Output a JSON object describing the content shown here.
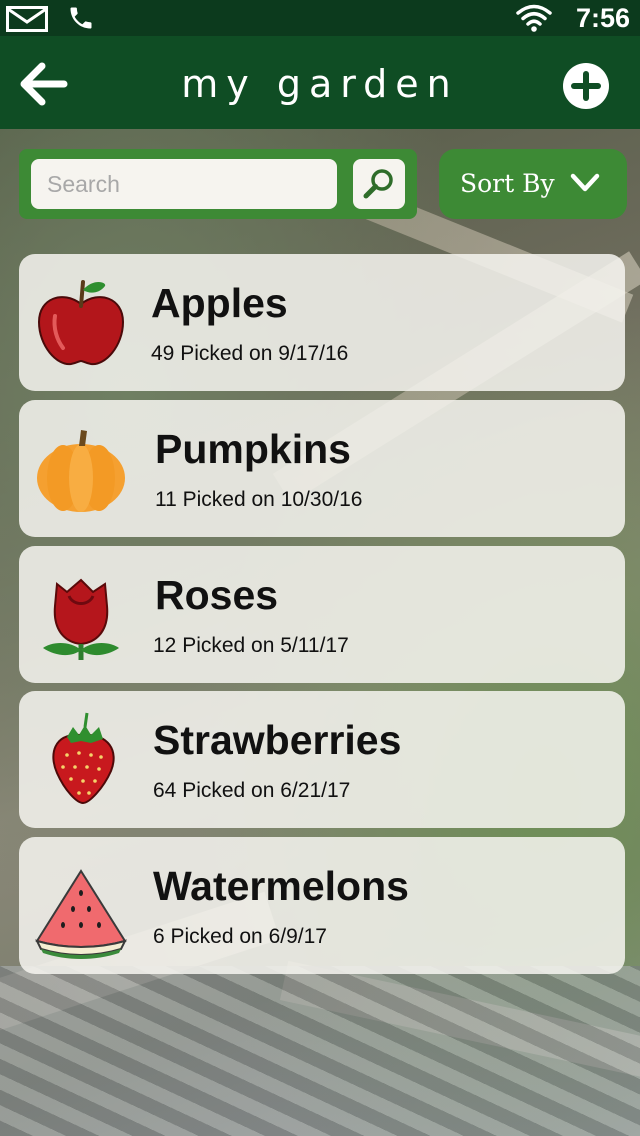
{
  "status_bar": {
    "time": "7:56",
    "icons": [
      "mail-icon",
      "phone-icon",
      "wifi-icon"
    ]
  },
  "app_bar": {
    "title": "my garden",
    "back_icon": "arrow-left-icon",
    "add_icon": "plus-circle-icon"
  },
  "search": {
    "placeholder": "Search",
    "value": "",
    "button_icon": "magnifier-icon"
  },
  "sort": {
    "label": "Sort By",
    "icon": "chevron-down-icon"
  },
  "colors": {
    "status_bar": "#0c3a1d",
    "app_bar": "#0f4d24",
    "accent_green": "#3d8a35",
    "card_bg": "#f6f4f0"
  },
  "items": [
    {
      "name": "Apples",
      "picked": "49 Picked on 9/17/16",
      "icon": "apple-icon"
    },
    {
      "name": "Pumpkins",
      "picked": "11 Picked on 10/30/16",
      "icon": "pumpkin-icon"
    },
    {
      "name": "Roses",
      "picked": "12 Picked on 5/11/17",
      "icon": "rose-icon"
    },
    {
      "name": "Strawberries",
      "picked": "64 Picked on 6/21/17",
      "icon": "strawberry-icon"
    },
    {
      "name": "Watermelons",
      "picked": "6 Picked on 6/9/17",
      "icon": "watermelon-icon"
    }
  ]
}
